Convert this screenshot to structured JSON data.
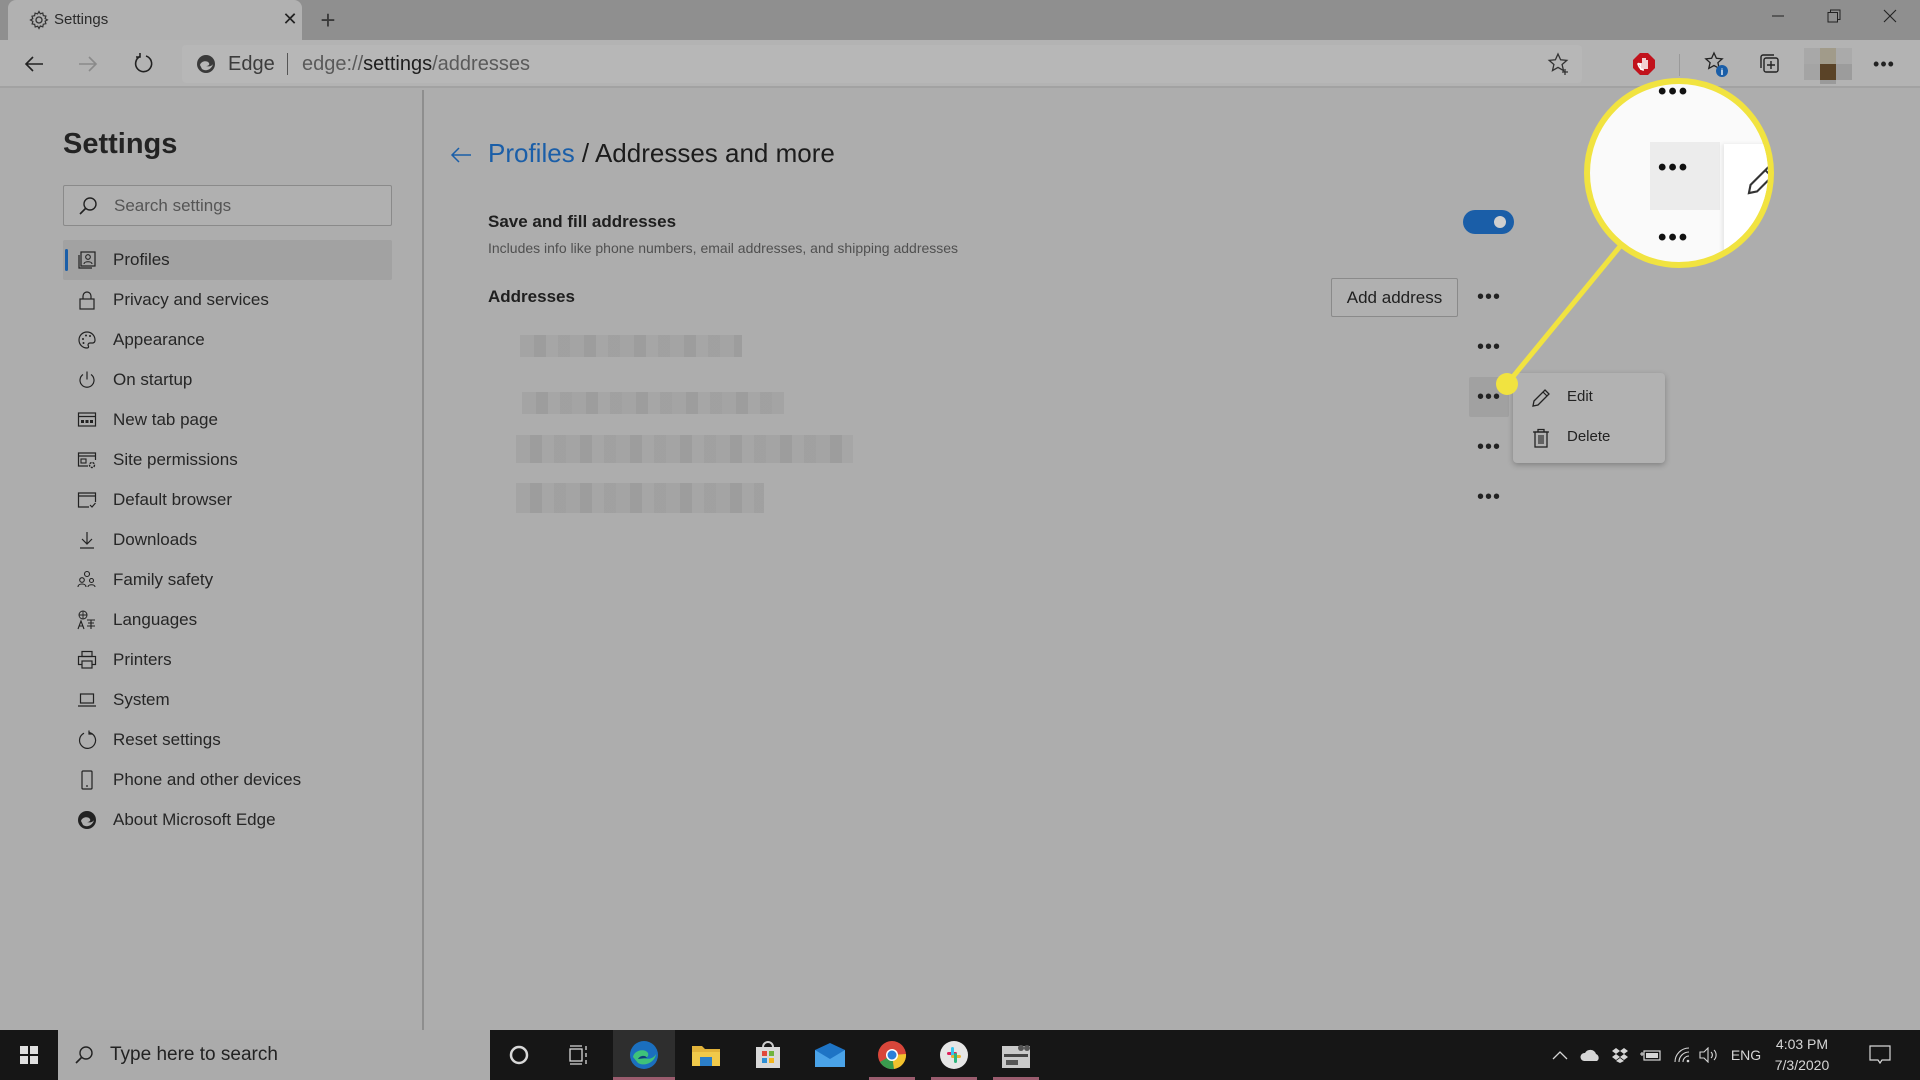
{
  "browser": {
    "tab": {
      "title": "Settings",
      "icon": "gear-icon",
      "close_icon": "close-icon"
    },
    "new_tab_icon": "plus-icon",
    "window_controls": [
      "minimize-icon",
      "restore-icon",
      "close-icon"
    ],
    "address_bar": {
      "site_label": "Edge",
      "url_prefix": "edge://",
      "url_host": "settings",
      "url_path": "/addresses"
    },
    "toolbar_icons": [
      "favorite-add-icon",
      "adblock-extension-icon",
      "favorites-icon",
      "collections-icon",
      "profile-avatar",
      "more-icon"
    ],
    "notification_badge": "i"
  },
  "sidebar": {
    "title": "Settings",
    "search_placeholder": "Search settings",
    "items": [
      {
        "label": "Profiles",
        "icon": "profiles-icon",
        "active": true
      },
      {
        "label": "Privacy and services",
        "icon": "lock-icon"
      },
      {
        "label": "Appearance",
        "icon": "palette-icon"
      },
      {
        "label": "On startup",
        "icon": "power-icon"
      },
      {
        "label": "New tab page",
        "icon": "new-tab-icon"
      },
      {
        "label": "Site permissions",
        "icon": "site-permissions-icon"
      },
      {
        "label": "Default browser",
        "icon": "default-browser-icon"
      },
      {
        "label": "Downloads",
        "icon": "download-icon"
      },
      {
        "label": "Family safety",
        "icon": "family-icon"
      },
      {
        "label": "Languages",
        "icon": "languages-icon"
      },
      {
        "label": "Printers",
        "icon": "printer-icon"
      },
      {
        "label": "System",
        "icon": "laptop-icon"
      },
      {
        "label": "Reset settings",
        "icon": "reset-icon"
      },
      {
        "label": "Phone and other devices",
        "icon": "phone-icon"
      },
      {
        "label": "About Microsoft Edge",
        "icon": "edge-icon"
      }
    ]
  },
  "main": {
    "breadcrumb": {
      "parent": "Profiles",
      "separator": " / ",
      "current": "Addresses and more"
    },
    "save_fill": {
      "title": "Save and fill addresses",
      "description": "Includes info like phone numbers, email addresses, and shipping addresses",
      "enabled": true
    },
    "addresses": {
      "label": "Addresses",
      "add_button": "Add address",
      "more_label": "...",
      "rows": [
        {
          "value": "[redacted]"
        },
        {
          "value": "[redacted]"
        },
        {
          "value": "[redacted]"
        },
        {
          "value": "[redacted]"
        }
      ]
    },
    "context_menu": {
      "items": [
        {
          "label": "Edit",
          "icon": "pencil-icon"
        },
        {
          "label": "Delete",
          "icon": "trash-icon"
        }
      ]
    },
    "callout": {
      "color": "#f1e340"
    }
  },
  "taskbar": {
    "search_placeholder": "Type here to search",
    "apps": [
      "cortana-icon",
      "task-view-icon",
      "edge-app-icon",
      "file-explorer-icon",
      "store-icon",
      "mail-icon",
      "chrome-icon",
      "slack-icon",
      "app-icon"
    ],
    "tray": {
      "language": "ENG",
      "time": "4:03 PM",
      "date": "7/3/2020"
    }
  },
  "colors": {
    "accent": "#1a5ea8",
    "highlight": "#f1e340"
  }
}
